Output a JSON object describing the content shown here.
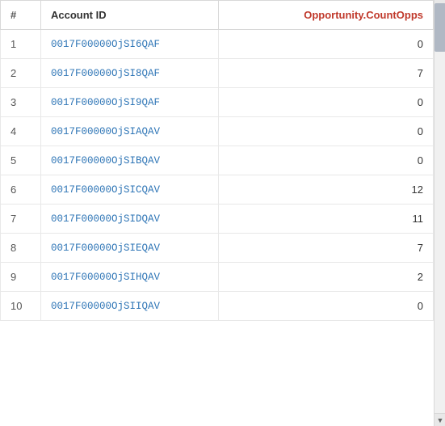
{
  "table": {
    "columns": {
      "hash": "#",
      "accountId": "Account ID",
      "countOpps": "Opportunity.CountOpps"
    },
    "rows": [
      {
        "num": 1,
        "accountId": "0017F00000OjSI6QAF",
        "countOpps": 0
      },
      {
        "num": 2,
        "accountId": "0017F00000OjSI8QAF",
        "countOpps": 7
      },
      {
        "num": 3,
        "accountId": "0017F00000OjSI9QAF",
        "countOpps": 0
      },
      {
        "num": 4,
        "accountId": "0017F00000OjSIAQAV",
        "countOpps": 0
      },
      {
        "num": 5,
        "accountId": "0017F00000OjSIBQAV",
        "countOpps": 0
      },
      {
        "num": 6,
        "accountId": "0017F00000OjSICQAV",
        "countOpps": 12
      },
      {
        "num": 7,
        "accountId": "0017F00000OjSIDQAV",
        "countOpps": 11
      },
      {
        "num": 8,
        "accountId": "0017F00000OjSIEQAV",
        "countOpps": 7
      },
      {
        "num": 9,
        "accountId": "0017F00000OjSIHQAV",
        "countOpps": 2
      },
      {
        "num": 10,
        "accountId": "0017F00000OjSIIQAV",
        "countOpps": 0
      }
    ]
  },
  "scrollbar": {
    "up_arrow": "▲",
    "down_arrow": "▼"
  }
}
